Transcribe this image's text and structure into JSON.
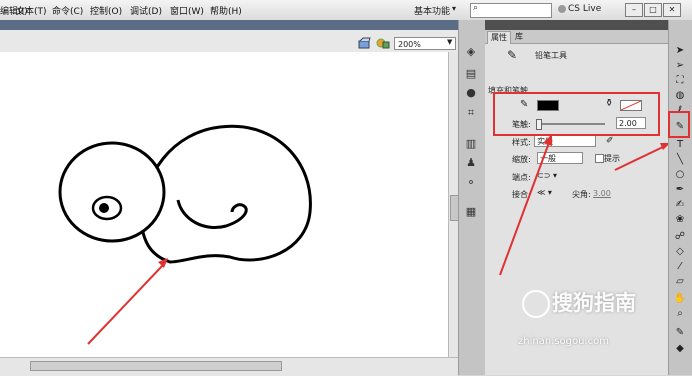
{
  "menubar": {
    "items": [
      "编辑(I)",
      "文本(T)",
      "命令(C)",
      "控制(O)",
      "调试(D)",
      "窗口(W)",
      "帮助(H)"
    ],
    "workspace": "基本功能",
    "search_placeholder": "",
    "cslive": "CS Live"
  },
  "stage": {
    "zoom": "200%"
  },
  "panel": {
    "tabs": [
      "属性",
      "库"
    ],
    "tool_name": "铅笔工具",
    "section_fill_stroke": "填充和笔触",
    "stroke_label": "笔触:",
    "stroke_value": "2.00",
    "style_label": "样式:",
    "style_value": "实线",
    "scale_label": "缩放:",
    "scale_value": "一般",
    "hint_label": "提示",
    "cap_label": "端点:",
    "join_label": "接合:",
    "miter_label": "尖角:",
    "miter_value": "3.00"
  },
  "watermark": {
    "text": "搜狗指南",
    "url": "zhinan.sogou.com"
  },
  "colors": {
    "stroke": "#000000",
    "fill": "#ffffff",
    "highlight": "#e03232"
  }
}
